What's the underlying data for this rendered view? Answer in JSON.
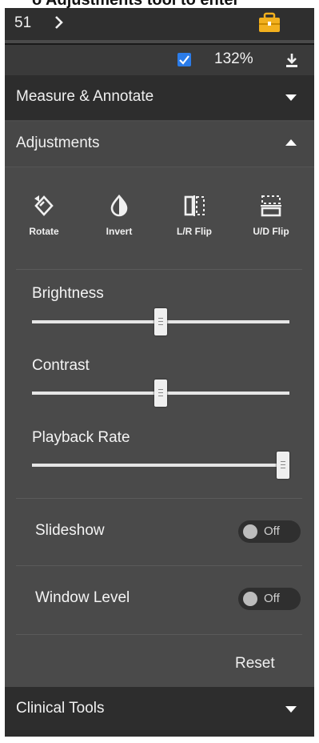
{
  "caption": "o Adjustments tool to enter",
  "topbar": {
    "series_number": "51",
    "chevron_icon": "chevron-right-icon",
    "tools_icon": "briefcase-icon",
    "accent": "#f2b01e"
  },
  "viewer": {
    "zoom": "132%",
    "fit_checkbox_checked": true,
    "download_icon": "download-icon"
  },
  "sections": {
    "measure": {
      "label": "Measure & Annotate",
      "expanded": false
    },
    "adjustments": {
      "label": "Adjustments",
      "expanded": true
    },
    "clinical": {
      "label": "Clinical Tools",
      "expanded": false
    }
  },
  "adjustments": {
    "tools": [
      {
        "label": "Rotate",
        "icon": "rotate-icon"
      },
      {
        "label": "Invert",
        "icon": "invert-icon"
      },
      {
        "label": "L/R Flip",
        "icon": "lr-flip-icon"
      },
      {
        "label": "U/D Flip",
        "icon": "ud-flip-icon"
      }
    ],
    "sliders": [
      {
        "label": "Brightness",
        "value": 0.5
      },
      {
        "label": "Contrast",
        "value": 0.5
      },
      {
        "label": "Playback Rate",
        "value": 1.0
      }
    ],
    "toggles": [
      {
        "label": "Slideshow",
        "state": "Off"
      },
      {
        "label": "Window Level",
        "state": "Off"
      }
    ],
    "reset_label": "Reset"
  }
}
